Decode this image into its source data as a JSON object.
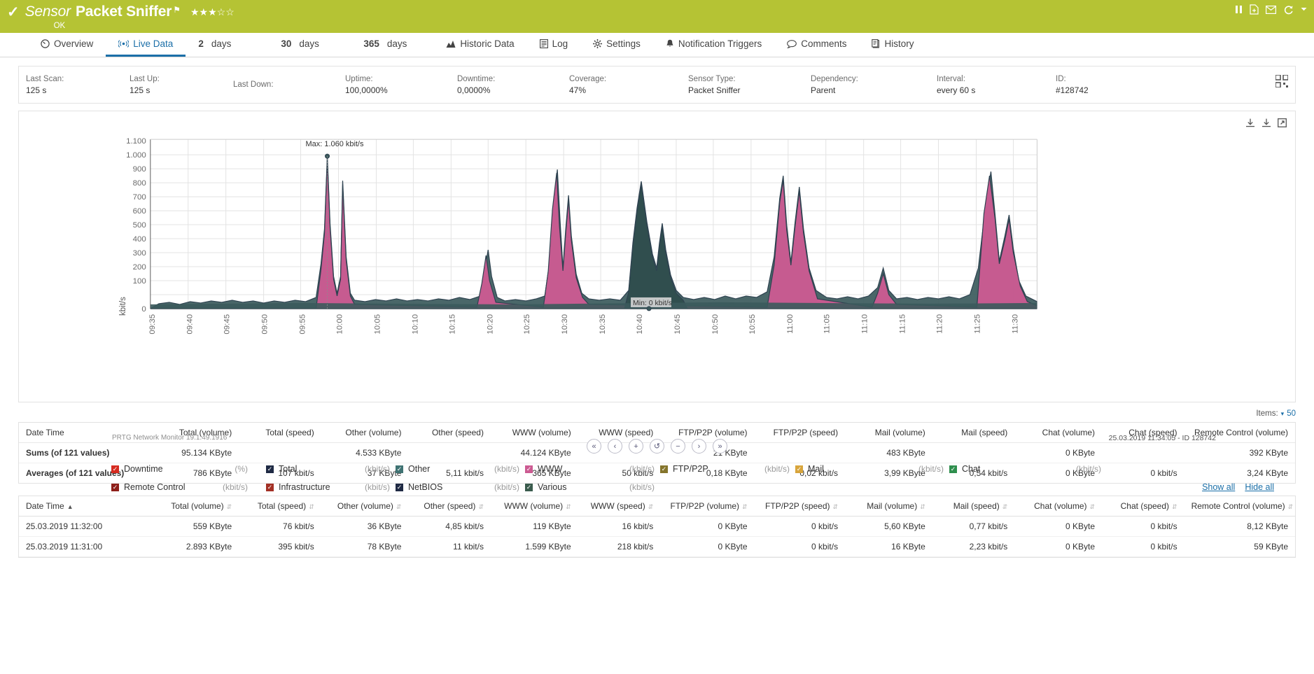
{
  "header": {
    "status_icon": "check-icon",
    "kind": "Sensor",
    "name": "Packet Sniffer",
    "flag": "⚑",
    "stars": "★★★☆☆",
    "status": "OK",
    "accent_color": "#b5c334",
    "icons": [
      {
        "name": "pause-icon",
        "glyph": "▐▌"
      },
      {
        "name": "add-report-icon",
        "glyph": "὜e"
      },
      {
        "name": "mail-icon",
        "glyph": "✉"
      },
      {
        "name": "refresh-icon",
        "glyph": "↻"
      },
      {
        "name": "chevron-down-icon",
        "glyph": "▾"
      }
    ]
  },
  "tabs": [
    {
      "label": "Overview",
      "icon": "gauge-icon",
      "glyph": "◔",
      "active": false
    },
    {
      "label": "Live Data",
      "icon": "live-signal-icon",
      "glyph": "((•))",
      "active": true
    },
    {
      "num": "2",
      "label": "days",
      "icon": "",
      "glyph": "",
      "active": false
    },
    {
      "num": "30",
      "label": "days",
      "icon": "",
      "glyph": "",
      "active": false
    },
    {
      "num": "365",
      "label": "days",
      "icon": "",
      "glyph": "",
      "active": false
    },
    {
      "label": "Historic Data",
      "icon": "chart-icon",
      "glyph": "Ὄa",
      "active": false
    },
    {
      "label": "Log",
      "icon": "log-icon",
      "glyph": "☰",
      "active": false
    },
    {
      "label": "Settings",
      "icon": "gear-icon",
      "glyph": "⚙",
      "active": false
    },
    {
      "label": "Notification Triggers",
      "icon": "bell-icon",
      "glyph": "ὑ4",
      "active": false
    },
    {
      "label": "Comments",
      "icon": "comment-icon",
      "glyph": "◯",
      "active": false
    },
    {
      "label": "History",
      "icon": "history-icon",
      "glyph": "Ὄb",
      "active": false
    }
  ],
  "info": [
    {
      "label": "Last Scan:",
      "value": "125 s"
    },
    {
      "label": "Last Up:",
      "value": "125 s"
    },
    {
      "label": "Last Down:",
      "value": ""
    },
    {
      "label": "Uptime:",
      "value": "100,0000%"
    },
    {
      "label": "Downtime:",
      "value": "0,0000%"
    },
    {
      "label": "Coverage:",
      "value": "47%"
    },
    {
      "label": "Sensor Type:",
      "value": "Packet Sniffer"
    },
    {
      "label": "Dependency:",
      "value": "Parent"
    },
    {
      "label": "Interval:",
      "value": "every 60 s"
    },
    {
      "label": "ID:",
      "value": "#128742"
    }
  ],
  "chart": {
    "tools": [
      {
        "name": "download-icon",
        "glyph": "⤓"
      },
      {
        "name": "save-icon",
        "glyph": "⤓"
      },
      {
        "name": "popout-icon",
        "glyph": "↗"
      }
    ],
    "max_annotation": "Max: 1.060 kbit/s",
    "min_annotation": "Min: 0 kbit/s",
    "version_text": "PRTG Network Monitor 19.1.49.1916",
    "stamp": "25.03.2019 11:34:05 - ID 128742",
    "nav": [
      {
        "name": "nav-first",
        "glyph": "«"
      },
      {
        "name": "nav-prev",
        "glyph": "‹"
      },
      {
        "name": "nav-zoom-in",
        "glyph": "+"
      },
      {
        "name": "nav-reset",
        "glyph": "↺"
      },
      {
        "name": "nav-zoom-out",
        "glyph": "−"
      },
      {
        "name": "nav-next",
        "glyph": "›"
      },
      {
        "name": "nav-last",
        "glyph": "»"
      }
    ]
  },
  "chart_data": {
    "type": "area",
    "title": "",
    "xlabel": "",
    "ylabel": "kbit/s",
    "ylim": [
      0,
      1150
    ],
    "yticks": [
      0,
      100,
      200,
      300,
      400,
      500,
      600,
      700,
      800,
      900,
      1000,
      1100
    ],
    "ytick_labels": [
      "0",
      "100",
      "200",
      "300",
      "400",
      "500",
      "600",
      "700",
      "800",
      "900",
      "1.000",
      "1.100"
    ],
    "xtick_labels": [
      "09:35",
      "09:40",
      "09:45",
      "09:50",
      "09:55",
      "10:00",
      "10:05",
      "10:10",
      "10:15",
      "10:20",
      "10:25",
      "10:30",
      "10:35",
      "10:40",
      "10:45",
      "10:50",
      "10:55",
      "11:00",
      "11:05",
      "11:10",
      "11:15",
      "11:20",
      "11:25",
      "11:30"
    ],
    "grid": true,
    "legend_position": "below",
    "annotations": [
      {
        "text": "Max: 1.060 kbit/s",
        "x": "10:00",
        "y": 1060
      },
      {
        "text": "Min: 0 kbit/s",
        "x": "10:43",
        "y": 0
      }
    ],
    "series": [
      {
        "name": "Total",
        "color": "#2e4250",
        "unit": "kbit/s",
        "x": [
          "09:35",
          "09:37",
          "09:39",
          "09:41",
          "09:43",
          "09:45",
          "09:47",
          "09:49",
          "09:51",
          "09:53",
          "09:55",
          "09:57",
          "09:58",
          "09:59",
          "10:00",
          "10:01",
          "10:02",
          "10:03",
          "10:04",
          "10:05",
          "10:07",
          "10:09",
          "10:11",
          "10:13",
          "10:15",
          "10:17",
          "10:19",
          "10:20",
          "10:21",
          "10:22",
          "10:24",
          "10:26",
          "10:28",
          "10:29",
          "10:30",
          "10:31",
          "10:32",
          "10:33",
          "10:34",
          "10:36",
          "10:38",
          "10:39",
          "10:40",
          "10:41",
          "10:42",
          "10:43",
          "10:44",
          "10:45",
          "10:46",
          "10:48",
          "10:50",
          "10:52",
          "10:54",
          "10:56",
          "10:58",
          "10:59",
          "11:00",
          "11:01",
          "11:02",
          "11:03",
          "11:04",
          "11:05",
          "11:07",
          "11:09",
          "11:11",
          "11:13",
          "11:15",
          "11:16",
          "11:17",
          "11:19",
          "11:21",
          "11:23",
          "11:25",
          "11:27",
          "11:29",
          "11:30",
          "11:31",
          "11:32"
        ],
        "values": [
          30,
          40,
          35,
          45,
          40,
          50,
          45,
          60,
          55,
          50,
          60,
          80,
          300,
          1060,
          1060,
          400,
          120,
          780,
          200,
          70,
          60,
          55,
          60,
          65,
          60,
          70,
          120,
          380,
          150,
          70,
          60,
          55,
          60,
          300,
          960,
          500,
          760,
          300,
          80,
          70,
          120,
          500,
          880,
          300,
          120,
          40,
          90,
          150,
          170,
          110,
          80,
          90,
          120,
          150,
          300,
          740,
          500,
          810,
          350,
          130,
          90,
          70,
          80,
          75,
          90,
          240,
          120,
          100,
          110,
          90,
          80,
          95,
          100,
          300,
          900,
          400,
          120
        ]
      },
      {
        "name": "WWW",
        "color": "#cc5b92",
        "unit": "kbit/s",
        "x": [
          "09:35",
          "09:59",
          "10:00",
          "10:03",
          "10:20",
          "10:30",
          "10:32",
          "10:40",
          "11:00",
          "11:02",
          "11:30",
          "11:32"
        ],
        "values": [
          5,
          1000,
          1040,
          760,
          360,
          930,
          740,
          20,
          720,
          800,
          880,
          90
        ]
      },
      {
        "name": "Other",
        "color": "#3f7373",
        "unit": "kbit/s",
        "x": [
          "09:35",
          "10:00",
          "10:30",
          "10:40",
          "11:00",
          "11:30"
        ],
        "values": [
          25,
          40,
          40,
          860,
          60,
          40
        ]
      },
      {
        "name": "Downtime",
        "color": "#d62b20",
        "unit": "%",
        "values": []
      },
      {
        "name": "FTP/P2P",
        "color": "#85752c",
        "unit": "kbit/s",
        "values": []
      },
      {
        "name": "Mail",
        "color": "#d8a53c",
        "unit": "kbit/s",
        "values": []
      },
      {
        "name": "Chat",
        "color": "#2f8f4e",
        "unit": "kbit/s",
        "values": []
      },
      {
        "name": "Remote Control",
        "color": "#8e1f1a",
        "unit": "kbit/s",
        "values": []
      },
      {
        "name": "Infrastructure",
        "color": "#a33025",
        "unit": "kbit/s",
        "values": []
      },
      {
        "name": "NetBIOS",
        "color": "#1f2a44",
        "unit": "kbit/s",
        "values": []
      },
      {
        "name": "Various",
        "color": "#3a5c4d",
        "unit": "kbit/s",
        "values": []
      }
    ]
  },
  "legend": {
    "row1": [
      {
        "label": "Downtime",
        "unit": "(%)",
        "color": "#d62b20",
        "checked": true
      },
      {
        "label": "Total",
        "unit": "(kbit/s)",
        "color": "#1f2a44",
        "checked": true
      },
      {
        "label": "Other",
        "unit": "(kbit/s)",
        "color": "#3f7373",
        "checked": true
      },
      {
        "label": "WWW",
        "unit": "(kbit/s)",
        "color": "#cc5b92",
        "checked": true
      },
      {
        "label": "FTP/P2P",
        "unit": "(kbit/s)",
        "color": "#85752c",
        "checked": true
      },
      {
        "label": "Mail",
        "unit": "(kbit/s)",
        "color": "#d8a53c",
        "checked": true
      },
      {
        "label": "Chat",
        "unit": "(kbit/s)",
        "color": "#2f8f4e",
        "checked": true
      }
    ],
    "row2": [
      {
        "label": "Remote Control",
        "unit": "(kbit/s)",
        "color": "#8e1f1a",
        "checked": true
      },
      {
        "label": "Infrastructure",
        "unit": "(kbit/s)",
        "color": "#a33025",
        "checked": true
      },
      {
        "label": "NetBIOS",
        "unit": "(kbit/s)",
        "color": "#1f2a44",
        "checked": true
      },
      {
        "label": "Various",
        "unit": "(kbit/s)",
        "color": "#3a5c4d",
        "checked": true
      }
    ],
    "show_all": "Show all",
    "hide_all": "Hide all"
  },
  "items_selector": {
    "label": "Items:",
    "value": "50"
  },
  "summary_table": {
    "columns": [
      "Date Time",
      "Total (volume)",
      "Total (speed)",
      "Other (volume)",
      "Other (speed)",
      "WWW (volume)",
      "WWW (speed)",
      "FTP/P2P (volume)",
      "FTP/P2P (speed)",
      "Mail (volume)",
      "Mail (speed)",
      "Chat (volume)",
      "Chat (speed)",
      "Remote Control (volume)"
    ],
    "rows": [
      [
        "Sums (of 121 values)",
        "95.134 KByte",
        "",
        "4.533 KByte",
        "",
        "44.124 KByte",
        "",
        "21 KByte",
        "",
        "483 KByte",
        "",
        "0 KByte",
        "",
        "392 KByte"
      ],
      [
        "Averages (of 121 values)",
        "786 KByte",
        "107 kbit/s",
        "37 KByte",
        "5,11 kbit/s",
        "365 KByte",
        "50 kbit/s",
        "0,18 KByte",
        "0,02 kbit/s",
        "3,99 KByte",
        "0,54 kbit/s",
        "0 KByte",
        "0 kbit/s",
        "3,24 KByte"
      ]
    ]
  },
  "data_table": {
    "columns": [
      "Date Time",
      "Total (volume)",
      "Total (speed)",
      "Other (volume)",
      "Other (speed)",
      "WWW (volume)",
      "WWW (speed)",
      "FTP/P2P (volume)",
      "FTP/P2P (speed)",
      "Mail (volume)",
      "Mail (speed)",
      "Chat (volume)",
      "Chat (speed)",
      "Remote Control (volume)"
    ],
    "sorted_column": "Date Time",
    "sort_direction": "asc",
    "rows": [
      [
        "25.03.2019 11:32:00",
        "559 KByte",
        "76 kbit/s",
        "36 KByte",
        "4,85 kbit/s",
        "119 KByte",
        "16 kbit/s",
        "0 KByte",
        "0 kbit/s",
        "5,60 KByte",
        "0,77 kbit/s",
        "0 KByte",
        "0 kbit/s",
        "8,12 KByte"
      ],
      [
        "25.03.2019 11:31:00",
        "2.893 KByte",
        "395 kbit/s",
        "78 KByte",
        "11 kbit/s",
        "1.599 KByte",
        "218 kbit/s",
        "0 KByte",
        "0 kbit/s",
        "16 KByte",
        "2,23 kbit/s",
        "0 KByte",
        "0 kbit/s",
        "59 KByte"
      ]
    ]
  }
}
